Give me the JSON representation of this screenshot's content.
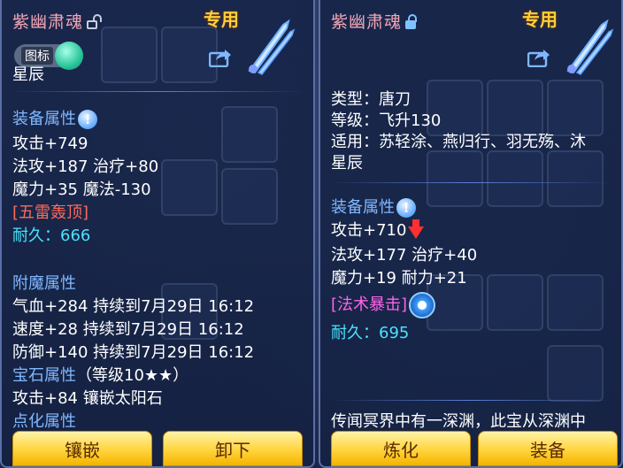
{
  "left_panel": {
    "item_name": "紫幽肃魂",
    "exclusive_tag": "专用",
    "icon_toggle_label": "图标",
    "partial_line": "星辰",
    "equip_attr_header": "装备属性",
    "equip_attrs": [
      "攻击+749",
      "法攻+187 治疗+80",
      "魔力+35 魔法-130"
    ],
    "special_skill": "[五雷轰顶]",
    "durability": "耐久：666",
    "enchant_header": "附魔属性",
    "enchant_attrs": [
      "气血+284 持续到7月29日 16:12",
      "速度+28 持续到7月29日 16:12",
      "防御+140 持续到7月29日 16:12"
    ],
    "gem_header": "宝石属性",
    "gem_level": "（等级10★★）",
    "gem_attr": "攻击+84 镶嵌太阳石",
    "refine_header": "点化属性",
    "buttons": [
      "镶嵌",
      "卸下"
    ]
  },
  "right_panel": {
    "item_name": "紫幽肃魂",
    "exclusive_tag": "专用",
    "type_line": "类型：唐刀",
    "level_line": "等级：飞升130",
    "applies_line1": "适用：苏轻涂、燕归行、羽无殇、沐",
    "applies_line2": "星辰",
    "equip_attr_header": "装备属性",
    "equip_attrs": [
      "攻击+710",
      "法攻+177 治疗+40",
      "魔力+19 耐力+21"
    ],
    "special_skill": "[法术暴击]",
    "durability": "耐久：695",
    "description": "传闻冥界中有一深渊，此宝从深渊中",
    "buttons": [
      "炼化",
      "装备"
    ]
  },
  "colors": {
    "title": "#f4a7b5",
    "exclusive": "#ffcf3a",
    "section": "#7fb8ff",
    "durability": "#49e3ff",
    "skill_left": "#ff6a58",
    "skill_right": "#ff63e9",
    "button": "#ffd43c"
  }
}
